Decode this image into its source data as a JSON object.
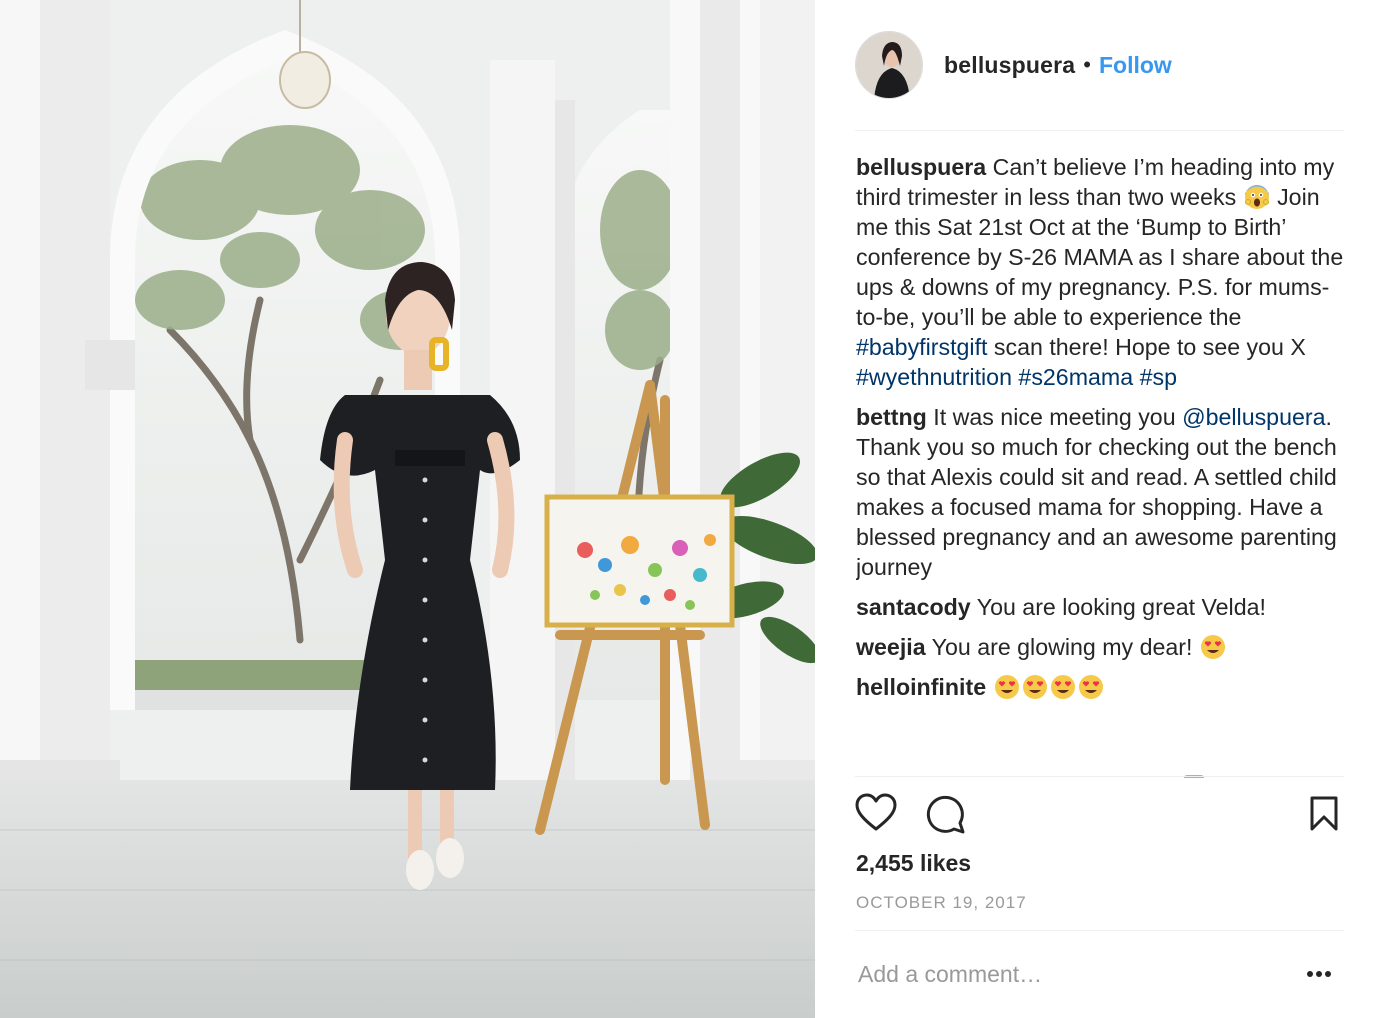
{
  "post": {
    "image_alt": "Woman in black off-shoulder dress walking in a white colonnade next to an easel with a painting"
  },
  "header": {
    "username": "belluspuera",
    "separator": "•",
    "follow_label": "Follow"
  },
  "caption": {
    "username": "belluspuera",
    "text_1": "Can’t believe I’m heading into my third trimester in less than two weeks",
    "emoji_1": "scream-emoji",
    "text_2": "Join me this Sat 21st Oct at the ‘Bump to Birth’ conference by S-26 MAMA as I share about the ups & downs of my pregnancy. P.S. for mums-to-be, you’ll be able to experience the",
    "hashtag_1": "#babyfirstgift",
    "text_3": "scan there! Hope to see you X",
    "hashtag_2": "#wyethnutrition",
    "hashtag_3": "#s26mama",
    "hashtag_4": "#sp"
  },
  "comments": [
    {
      "username": "bettng",
      "text_1": "It was nice meeting you",
      "mention": "@belluspuera",
      "text_2": ". Thank you so much for checking out the bench so that Alexis could sit and read. A settled child makes a focused mama for shopping. Have a blessed pregnancy and an awesome parenting journey"
    },
    {
      "username": "santacody",
      "text": "You are looking great Velda!"
    },
    {
      "username": "weejia",
      "text": "You are glowing my dear!",
      "emoji": "heart-eyes-emoji"
    },
    {
      "username": "helloinfinite",
      "emoji": "heart-eyes-emoji",
      "emoji_count": 4
    }
  ],
  "actions": {
    "icons": [
      "heart-icon",
      "comment-icon",
      "bookmark-icon"
    ]
  },
  "likes_label": "2,455 likes",
  "date_label": "OCTOBER 19, 2017",
  "add_comment": {
    "placeholder": "Add a comment…",
    "value": ""
  },
  "more_options_icon": "ellipsis-icon",
  "colors": {
    "link_blue": "#3897f0",
    "hashtag": "#003569",
    "text": "#262626",
    "muted": "#999999",
    "divider": "#efefef"
  }
}
